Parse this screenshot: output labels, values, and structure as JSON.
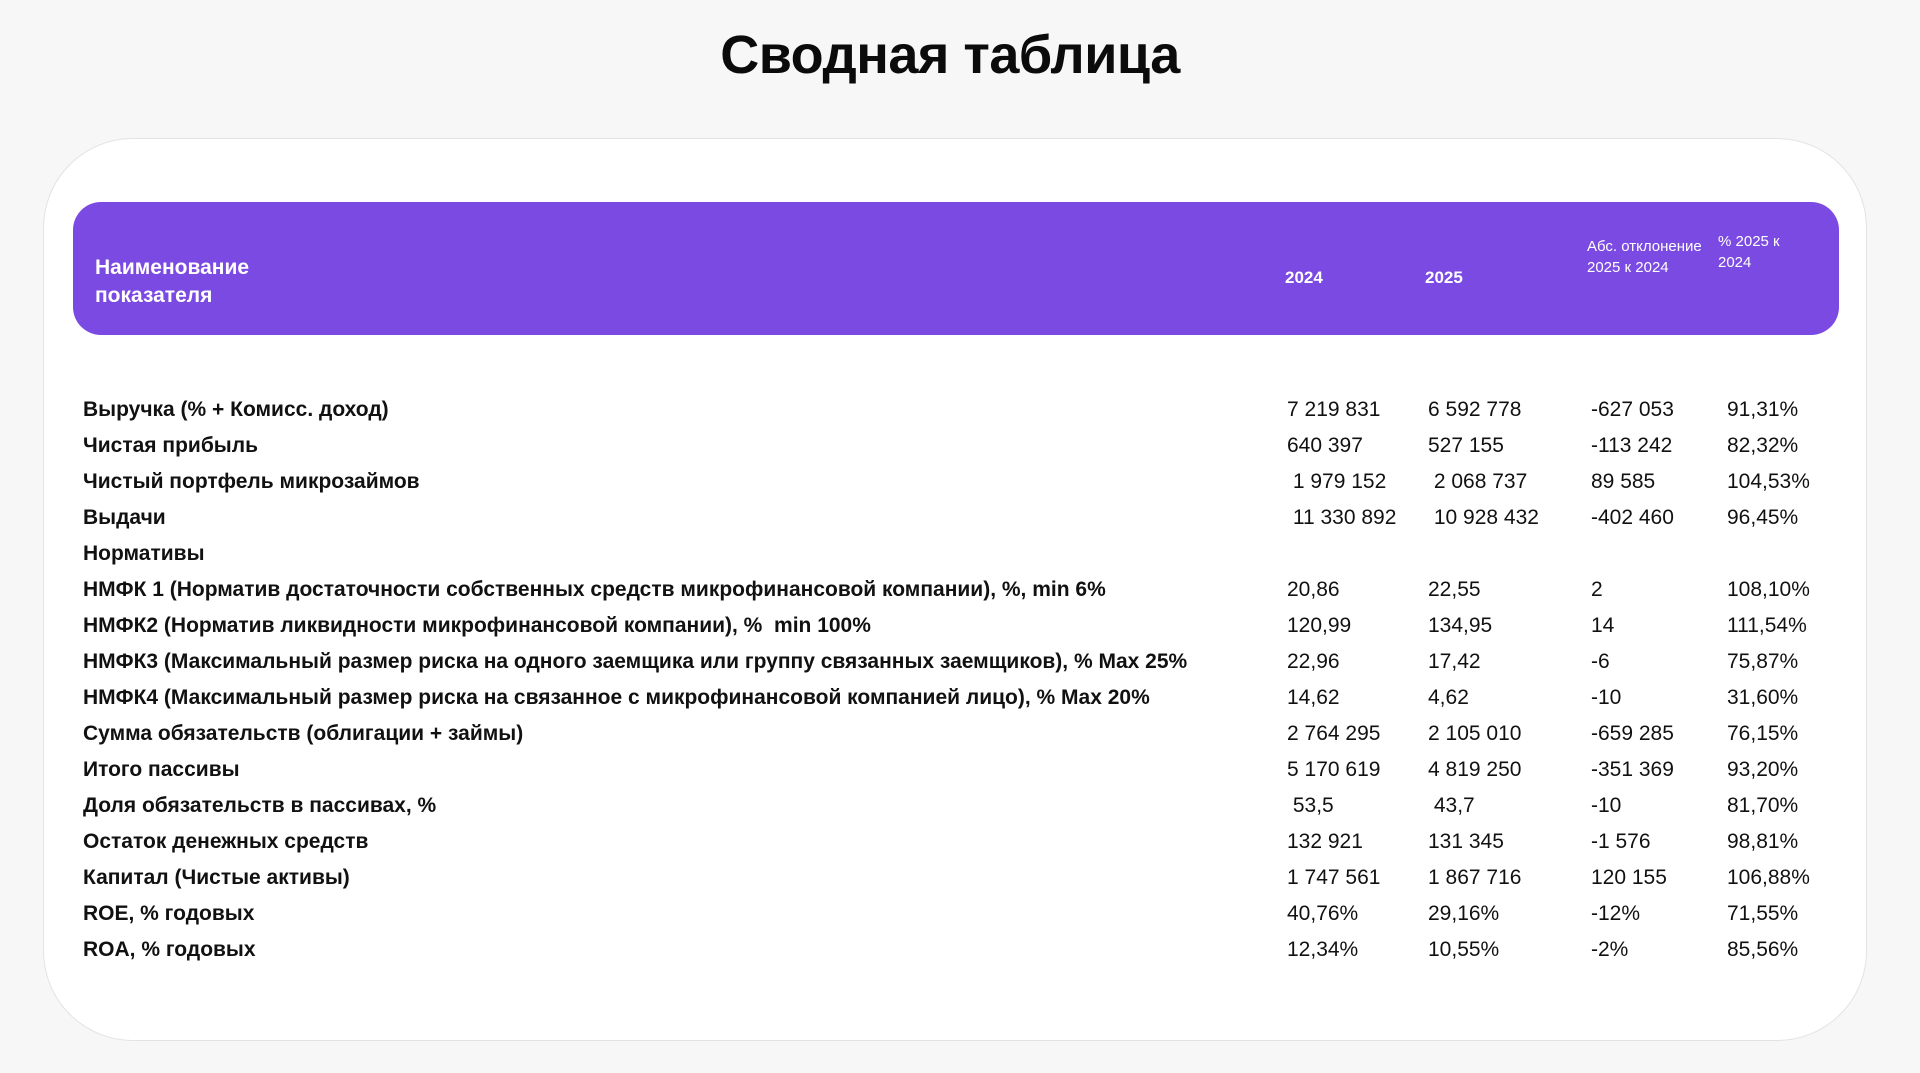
{
  "title": "Сводная таблица",
  "header": {
    "name": "Наименование показателя",
    "y2024": "2024",
    "y2025": "2025",
    "abs": "Абс. отклонение 2025 к 2024",
    "pct": "% 2025 к 2024"
  },
  "rows": [
    {
      "name": "Выручка (% + Комисс. доход)",
      "y2024": "7 219 831",
      "y2025": "6 592 778",
      "abs": "-627 053",
      "pct": "91,31%"
    },
    {
      "name": "Чистая прибыль",
      "y2024": "640 397",
      "y2025": "527 155",
      "abs": "-113 242",
      "pct": "82,32%"
    },
    {
      "name": "Чистый портфель микрозаймов",
      "y2024": " 1 979 152",
      "y2025": " 2 068 737",
      "abs": "89 585",
      "pct": "104,53%"
    },
    {
      "name": "Выдачи",
      "y2024": " 11 330 892",
      "y2025": " 10 928 432",
      "abs": "-402 460",
      "pct": "96,45%"
    },
    {
      "name": "Нормативы",
      "y2024": "",
      "y2025": "",
      "abs": "",
      "pct": ""
    },
    {
      "name": "НМФК 1 (Норматив достаточности собственных средств микрофинансовой компании), %, min 6%",
      "y2024": "20,86",
      "y2025": "22,55",
      "abs": "2",
      "pct": "108,10%"
    },
    {
      "name": "НМФК2 (Норматив ликвидности микрофинансовой компании), %  min 100%",
      "y2024": "120,99",
      "y2025": "134,95",
      "abs": "14",
      "pct": "111,54%"
    },
    {
      "name": "НМФК3 (Максимальный размер риска на одного заемщика или группу связанных заемщиков), % Max 25%",
      "y2024": "22,96",
      "y2025": "17,42",
      "abs": "-6",
      "pct": "75,87%"
    },
    {
      "name": "НМФК4 (Максимальный размер риска на связанное с микрофинансовой компанией лицо), % Max 20%",
      "y2024": "14,62",
      "y2025": "4,62",
      "abs": "-10",
      "pct": "31,60%"
    },
    {
      "name": "Сумма обязательств (облигации + займы)",
      "y2024": "2 764 295",
      "y2025": "2 105 010",
      "abs": "-659 285",
      "pct": "76,15%"
    },
    {
      "name": "Итого пассивы",
      "y2024": "5 170 619",
      "y2025": "4 819 250",
      "abs": "-351 369",
      "pct": "93,20%"
    },
    {
      "name": "Доля обязательств в пассивах, %",
      "y2024": " 53,5",
      "y2025": " 43,7",
      "abs": "-10",
      "pct": "81,70%"
    },
    {
      "name": "Остаток денежных средств",
      "y2024": "132 921",
      "y2025": "131 345",
      "abs": "-1 576",
      "pct": "98,81%"
    },
    {
      "name": "Капитал (Чистые активы)",
      "y2024": "1 747 561",
      "y2025": "1 867 716",
      "abs": "120 155",
      "pct": "106,88%"
    },
    {
      "name": "ROE, % годовых",
      "y2024": "40,76%",
      "y2025": "29,16%",
      "abs": "-12%",
      "pct": "71,55%"
    },
    {
      "name": "ROA, % годовых",
      "y2024": "12,34%",
      "y2025": "10,55%",
      "abs": "-2%",
      "pct": "85,56%"
    }
  ]
}
